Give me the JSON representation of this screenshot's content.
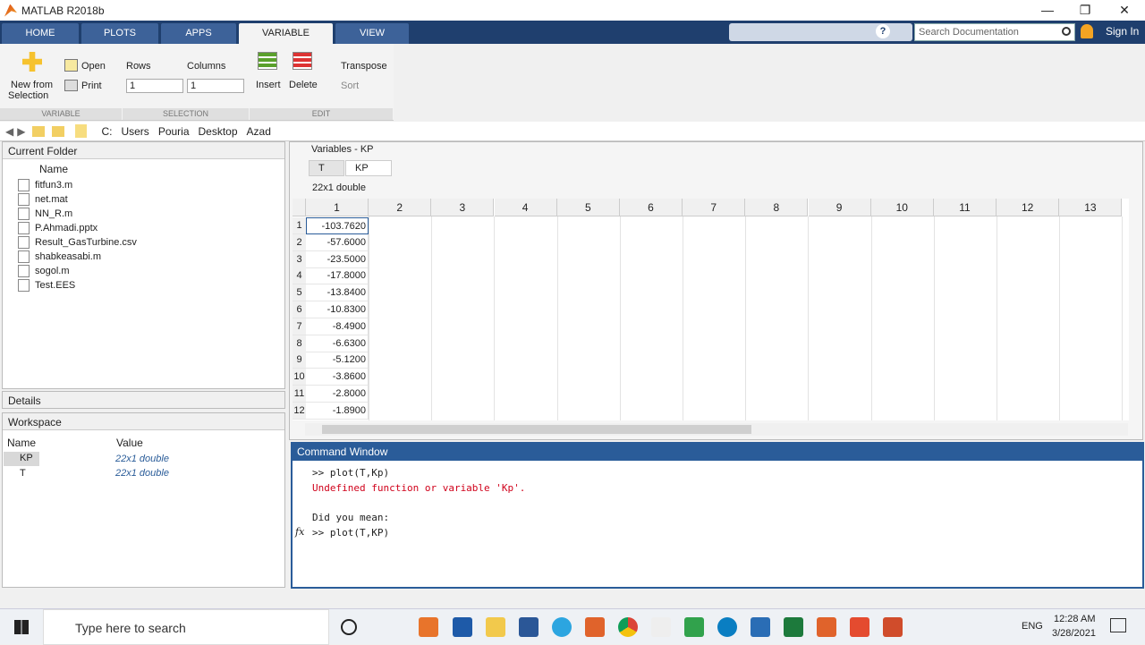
{
  "window": {
    "title": "MATLAB R2018b",
    "minimize": "—",
    "restore": "❐",
    "close": "✕"
  },
  "tabs": [
    "HOME",
    "PLOTS",
    "APPS",
    "VARIABLE",
    "VIEW"
  ],
  "search": {
    "placeholder": "Search Documentation"
  },
  "sign_in": "Sign In",
  "ribbon": {
    "new_from": "New from",
    "selection": "Selection",
    "open": "Open",
    "print": "Print",
    "rows": "Rows",
    "columns": "Columns",
    "rows_value": "1",
    "columns_value": "1",
    "insert": "Insert",
    "delete": "Delete",
    "transpose": "Transpose",
    "sort": "Sort",
    "sect_variable": "VARIABLE",
    "sect_selection": "SELECTION",
    "sect_edit": "EDIT"
  },
  "path": [
    "C:",
    "Users",
    "Pouria",
    "Desktop",
    "Azad"
  ],
  "current_folder": {
    "title": "Current Folder",
    "col": "Name",
    "files": [
      "fitfun3.m",
      "net.mat",
      "NN_R.m",
      "P.Ahmadi.pptx",
      "Result_GasTurbine.csv",
      "shabkeasabi.m",
      "sogol.m",
      "Test.EES"
    ]
  },
  "details": "Details",
  "workspace": {
    "title": "Workspace",
    "col_name": "Name",
    "col_value": "Value",
    "vars": [
      {
        "name": "KP",
        "value": "22x1 double"
      },
      {
        "name": "T",
        "value": "22x1 double"
      }
    ]
  },
  "variables": {
    "title": "Variables - KP",
    "tabs": [
      "T",
      "KP"
    ],
    "info": "22x1 double",
    "cols": [
      "1",
      "2",
      "3",
      "4",
      "5",
      "6",
      "7",
      "8",
      "9",
      "10",
      "11",
      "12",
      "13"
    ],
    "rows": [
      "1",
      "2",
      "3",
      "4",
      "5",
      "6",
      "7",
      "8",
      "9",
      "10",
      "11",
      "12"
    ],
    "values": [
      "-103.7620",
      "-57.6000",
      "-23.5000",
      "-17.8000",
      "-13.8400",
      "-10.8300",
      "-8.4900",
      "-6.6300",
      "-5.1200",
      "-3.8600",
      "-2.8000",
      "-1.8900"
    ]
  },
  "command": {
    "title": "Command Window",
    "line1": ">> plot(T,Kp)",
    "line2": "Undefined function or variable 'Kp'.",
    "line3": "Did you mean:",
    "line4": ">> plot(T,KP)",
    "fx": "fx"
  },
  "taskbar": {
    "search": "Type here to search",
    "lang": "ENG",
    "time": "12:28 AM",
    "date": "3/28/2021"
  },
  "colors": {
    "accent": "#1f3f6e",
    "error": "#d0021b",
    "cmd_border": "#2a5c99"
  }
}
